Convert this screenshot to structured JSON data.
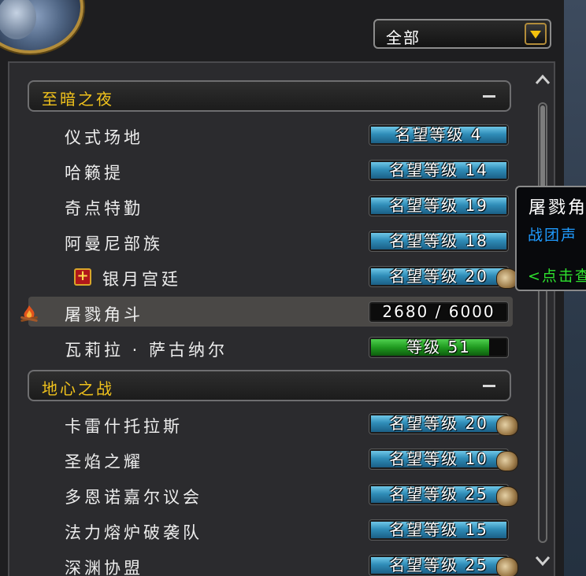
{
  "filter": {
    "label": "全部"
  },
  "sections": [
    {
      "title": "至暗之夜",
      "factions": [
        {
          "name": "仪式场地",
          "bar_text": "名望等级 4",
          "fill": 1.0,
          "bar_color": "#2f8db8"
        },
        {
          "name": "哈籁提",
          "bar_text": "名望等级 14",
          "fill": 1.0,
          "bar_color": "#2f8db8"
        },
        {
          "name": "奇点特勤",
          "bar_text": "名望等级 19",
          "fill": 1.0,
          "bar_color": "#2f8db8"
        },
        {
          "name": "阿曼尼部族",
          "bar_text": "名望等级 18",
          "fill": 1.0,
          "bar_color": "#2f8db8"
        },
        {
          "name": "银月宫廷",
          "bar_text": "名望等级 20",
          "fill": 1.0,
          "bar_color": "#2f8db8",
          "icon": "plus-icon",
          "reward_icon": "bag-icon"
        },
        {
          "name": "屠戮角斗",
          "bar_text": "2680 / 6000",
          "fill": 0.0,
          "icon": "campfire-icon",
          "selected": true
        },
        {
          "name": "瓦莉拉 · 萨古纳尔",
          "bar_text": "等级 51",
          "fill": 0.87,
          "bar_color": "#1f9a1f"
        }
      ]
    },
    {
      "title": "地心之战",
      "factions": [
        {
          "name": "卡雷什托拉斯",
          "bar_text": "名望等级 20",
          "fill": 1.0,
          "bar_color": "#2f8db8",
          "reward_icon": "bag-icon"
        },
        {
          "name": "圣焰之耀",
          "bar_text": "名望等级 10",
          "fill": 1.0,
          "bar_color": "#2f8db8",
          "reward_icon": "bag-icon"
        },
        {
          "name": "多恩诺嘉尔议会",
          "bar_text": "名望等级 25",
          "fill": 1.0,
          "bar_color": "#2f8db8",
          "reward_icon": "bag-icon"
        },
        {
          "name": "法力熔炉破袭队",
          "bar_text": "名望等级 15",
          "fill": 1.0,
          "bar_color": "#2f8db8"
        },
        {
          "name": "深渊协盟",
          "bar_text": "名望等级 25",
          "fill": 1.0,
          "bar_color": "#2f8db8",
          "reward_icon": "bag-icon"
        }
      ]
    }
  ],
  "tooltip": {
    "title": "屠戮角",
    "subtitle": "战团声",
    "hint": "<点击查"
  },
  "colors": {
    "section_title": "#f0c21c",
    "reputation_fill": "#2f8db8",
    "level_fill": "#1f9a1f"
  }
}
